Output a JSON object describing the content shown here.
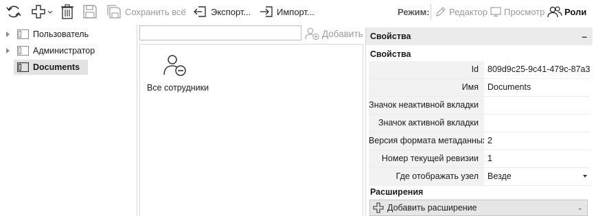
{
  "toolbar": {
    "save_all_label": "Сохранить всё",
    "export_label": "Экспорт...",
    "import_label": "Импорт...",
    "icons": [
      "refresh-icon",
      "add-icon",
      "delete-icon",
      "save-icon",
      "save-all-icon",
      "export-icon",
      "import-icon"
    ]
  },
  "mode": {
    "label": "Режим:",
    "options": [
      {
        "label": "Редактор",
        "icon": "pencil-icon",
        "active": false
      },
      {
        "label": "Просмотр",
        "icon": "monitor-icon",
        "active": false
      },
      {
        "label": "Роли",
        "icon": "users-icon",
        "active": true
      }
    ]
  },
  "tree": {
    "items": [
      {
        "label": "Пользователь",
        "expandable": true,
        "selected": false
      },
      {
        "label": "Администратор",
        "expandable": true,
        "selected": false
      },
      {
        "label": "Documents",
        "expandable": false,
        "selected": true
      }
    ]
  },
  "middle": {
    "search": {
      "value": "",
      "placeholder": ""
    },
    "add_label": "Добавить",
    "groups": [
      {
        "label": "Все сотрудники",
        "icon": "user-minus-icon"
      }
    ]
  },
  "properties": {
    "header": "Свойства",
    "collapse_symbol": "–",
    "section_main": "Свойства",
    "rows": [
      {
        "name": "Id",
        "value": "809d9c25-9c41-479c-87a3"
      },
      {
        "name": "Имя",
        "value": "Documents"
      },
      {
        "name": "Значок неактивной вкладки",
        "value": ""
      },
      {
        "name": "Значок активной вкладки",
        "value": ""
      },
      {
        "name": "Версия формата метаданных",
        "value": "2"
      },
      {
        "name": "Номер текущей ревизии",
        "value": "1"
      },
      {
        "name": "Где отображать узел",
        "value": "Везде"
      }
    ],
    "section_extensions": "Расширения",
    "add_extension_label": "Добавить расширение",
    "chevron": "⌄"
  },
  "colors": {
    "panel_header_bg": "#ebebeb",
    "selected_bg": "#e2e2e2",
    "disabled_text": "#9a9a9a",
    "prop_name_bg": "#f2f2f2"
  }
}
